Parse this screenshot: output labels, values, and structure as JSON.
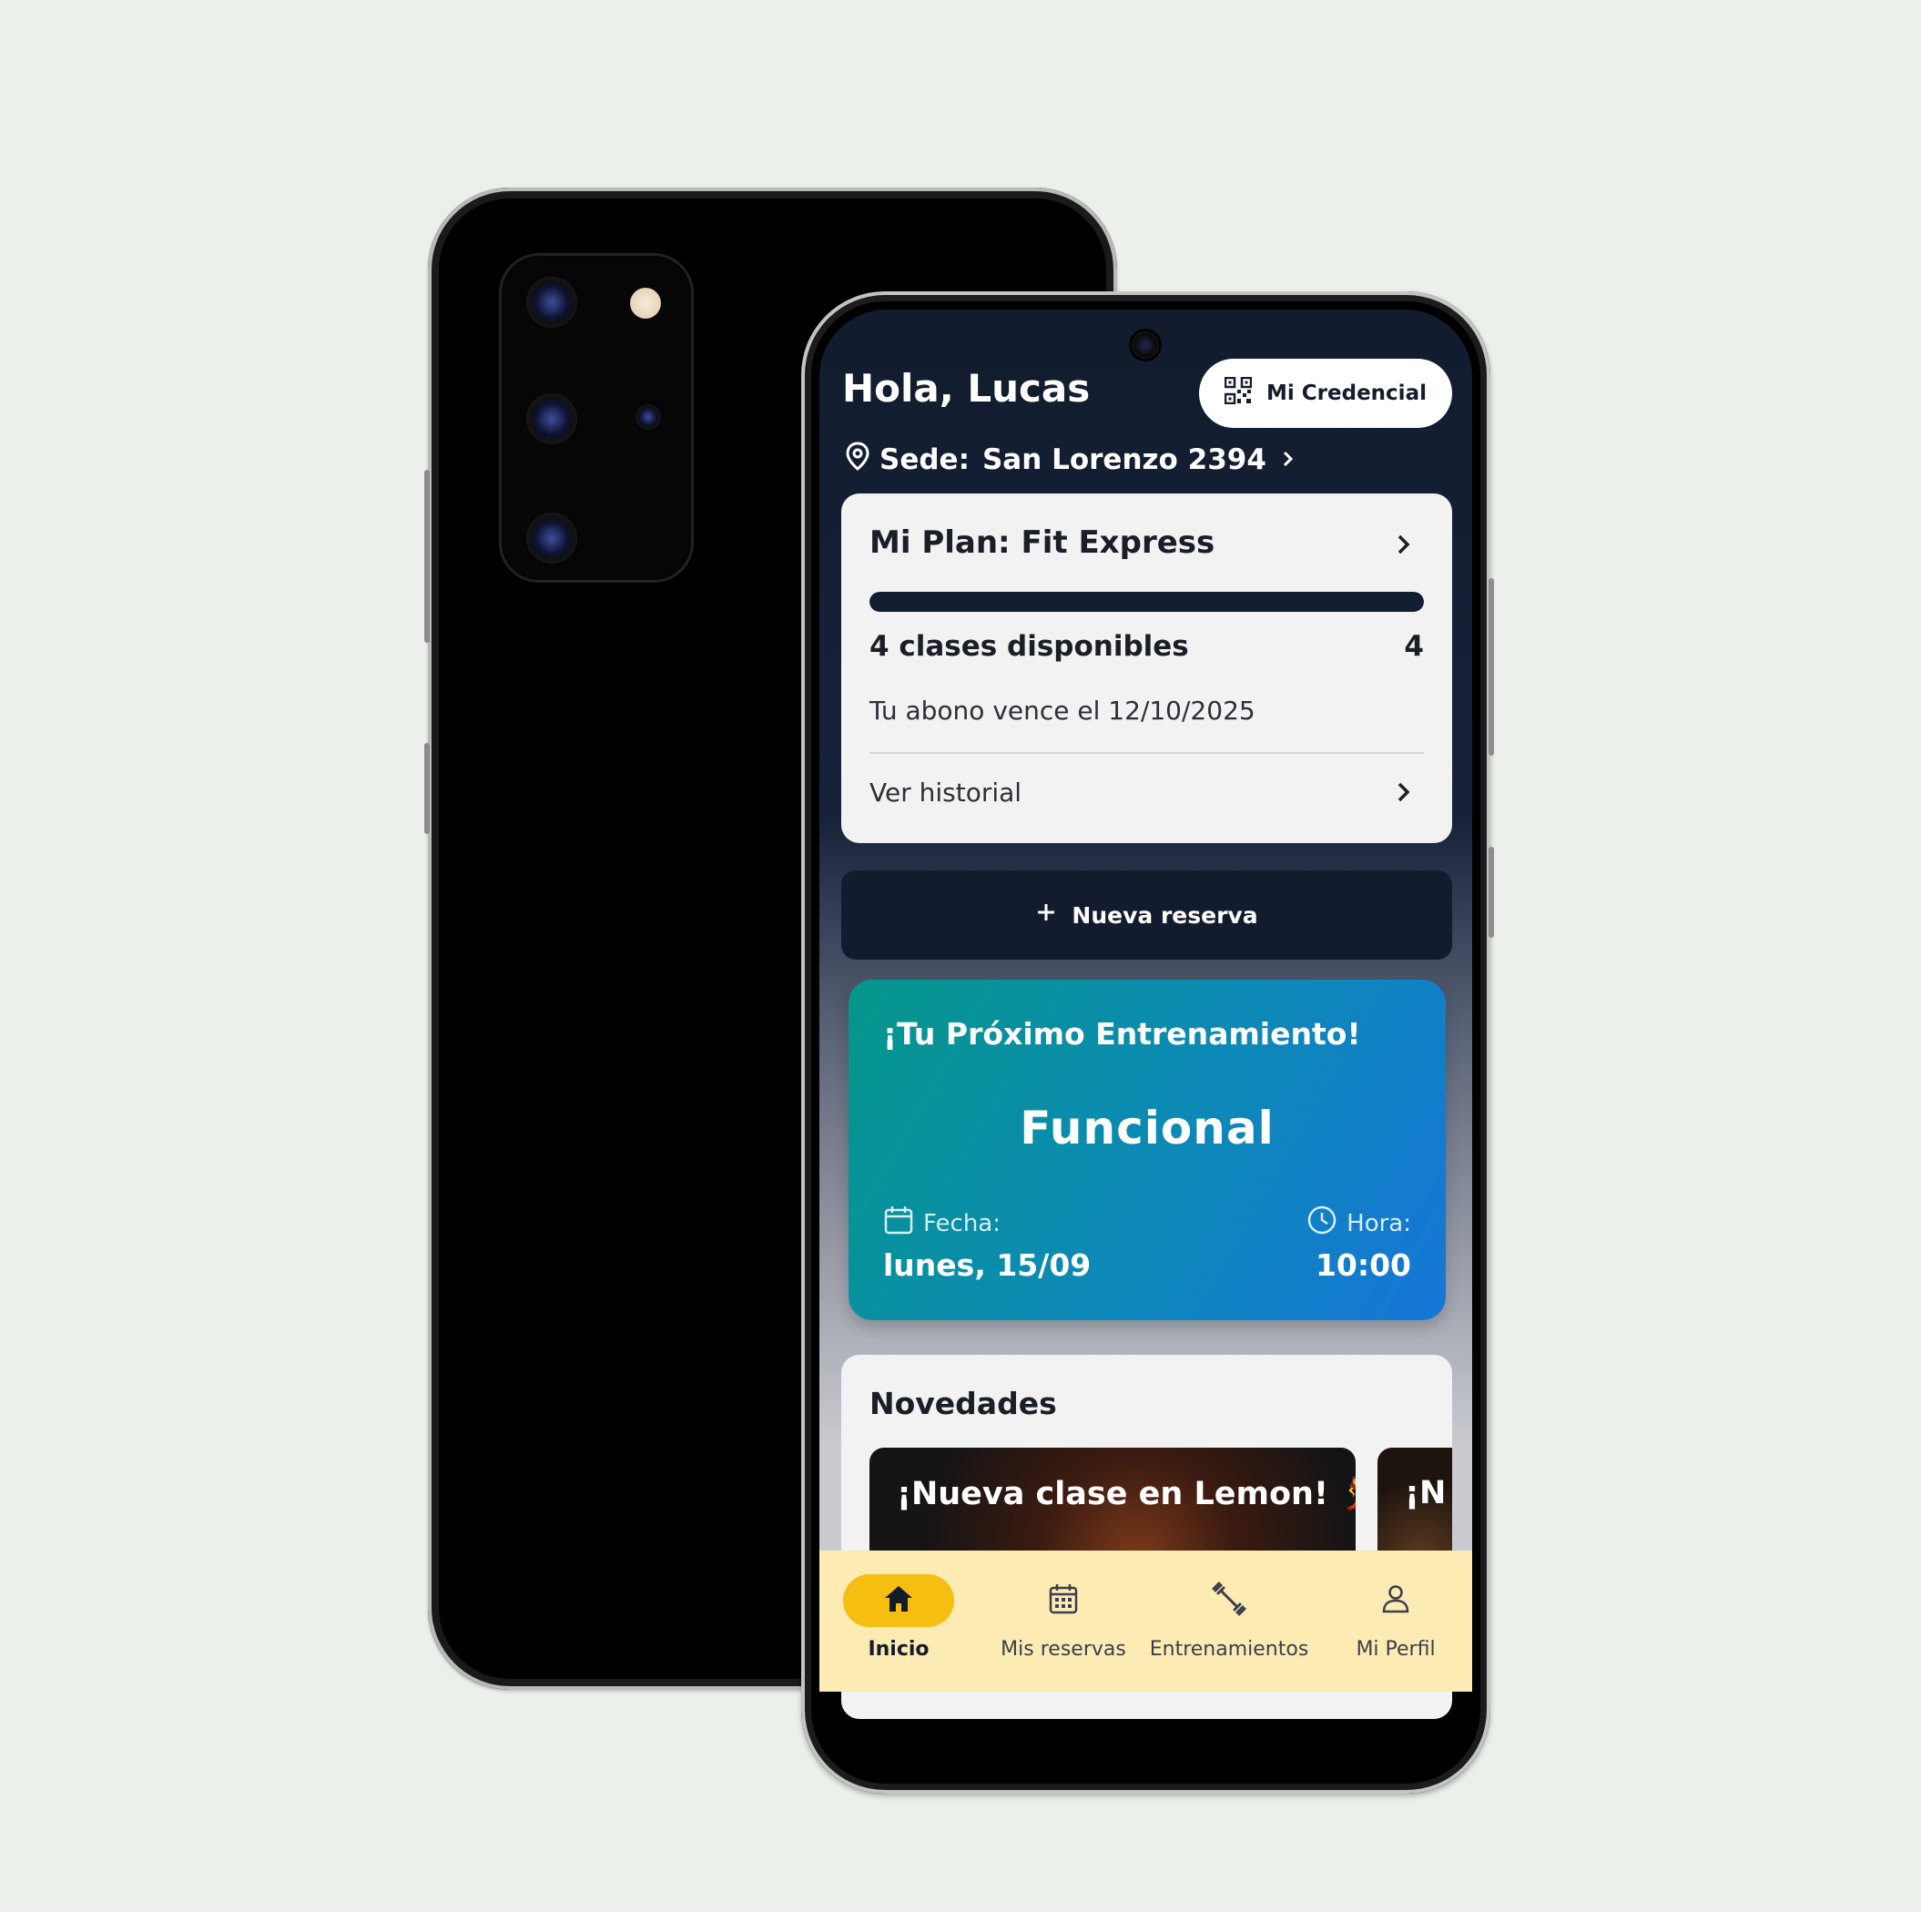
{
  "header": {
    "greeting": "Hola, Lucas",
    "credential_button": "Mi Credencial",
    "sede_label": "Sede:",
    "sede_value": "San Lorenzo 2394"
  },
  "plan": {
    "title": "Mi Plan: Fit Express",
    "progress_fraction": 1.0,
    "classes_label": "4 clases disponibles",
    "classes_count": "4",
    "expiry": "Tu abono vence el 12/10/2025",
    "history_link": "Ver historial"
  },
  "new_reservation": {
    "label": "Nueva reserva"
  },
  "next_training": {
    "title": "¡Tu Próximo Entrenamiento!",
    "class_name": "Funcional",
    "date_label": "Fecha:",
    "date_value": "lunes, 15/09",
    "time_label": "Hora:",
    "time_value": "10:00"
  },
  "news": {
    "title": "Novedades",
    "items": [
      {
        "headline": "¡Nueva clase en Lemon! 💃"
      },
      {
        "headline": "¡N"
      }
    ]
  },
  "bottom_nav": {
    "items": [
      {
        "label": "Inicio",
        "icon": "home-icon",
        "active": true
      },
      {
        "label": "Mis reservas",
        "icon": "calendar-icon",
        "active": false
      },
      {
        "label": "Entrenamientos",
        "icon": "dumbbell-icon",
        "active": false
      },
      {
        "label": "Mi Perfil",
        "icon": "person-icon",
        "active": false
      }
    ]
  },
  "colors": {
    "background": "#ebf1ea",
    "app_dark": "#131c2e",
    "nav_background": "#fdebb4",
    "nav_active": "#f7be12",
    "card_gradient_start": "#05968a",
    "card_gradient_end": "#1676d8"
  }
}
